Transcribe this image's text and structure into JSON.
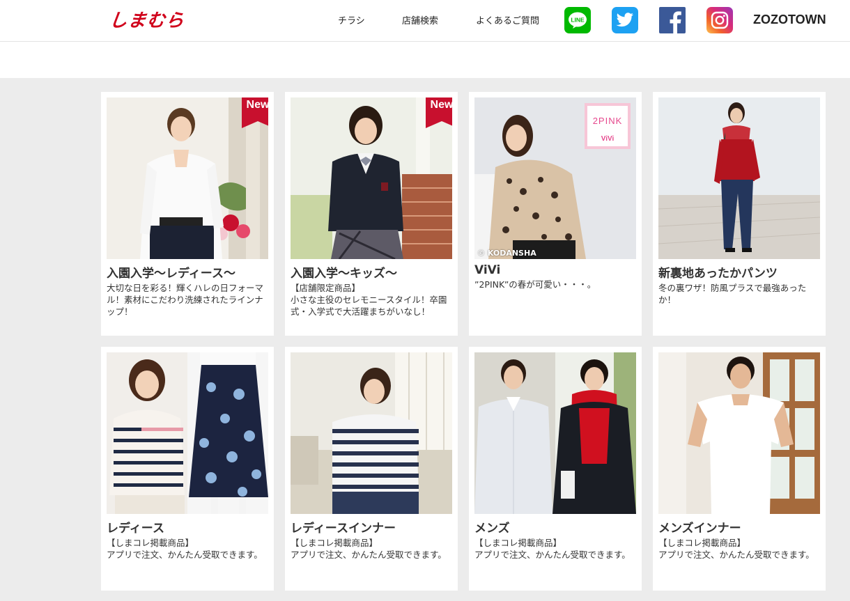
{
  "header": {
    "logo": "しまむら",
    "nav": [
      "チラシ",
      "店舗検索",
      "よくあるご質問"
    ],
    "sns": [
      {
        "name": "line",
        "label": "LINE",
        "color": "#00b900"
      },
      {
        "name": "twitter",
        "color": "#1da1f2"
      },
      {
        "name": "facebook",
        "color": "#3b5998"
      },
      {
        "name": "instagram",
        "color": "#c13584"
      }
    ],
    "zozotown": "ZOZOTOWN"
  },
  "badge_new": "New",
  "cards": [
    {
      "title": "入園入学～レディース～",
      "desc": "大切な日を彩る！輝くハレの日フォーマル！素材にこだわり洗練されたラインナップ！",
      "new": true
    },
    {
      "title": "入園入学～キッズ～",
      "desc": "【店舗限定商品】\n小さな主役のセレモニースタイル！卒園式・入学式で大活躍まちがいなし！",
      "new": true
    },
    {
      "title": "ViVi",
      "desc": "”2PINK”の春が可愛い・・・。",
      "credit": "© KODANSHA",
      "overlay_title": "2PINK",
      "overlay_sub": "ViVi"
    },
    {
      "title": "新裏地あったかパンツ",
      "desc": "冬の裏ワザ！防風プラスで最強あったか！"
    },
    {
      "title": "レディース",
      "desc": "【しまコレ掲載商品】\nアプリで注文、かんたん受取できます。"
    },
    {
      "title": "レディースインナー",
      "desc": "【しまコレ掲載商品】\nアプリで注文、かんたん受取できます。"
    },
    {
      "title": "メンズ",
      "desc": "【しまコレ掲載商品】\nアプリで注文、かんたん受取できます。"
    },
    {
      "title": "メンズインナー",
      "desc": "【しまコレ掲載商品】\nアプリで注文、かんたん受取できます。"
    }
  ]
}
